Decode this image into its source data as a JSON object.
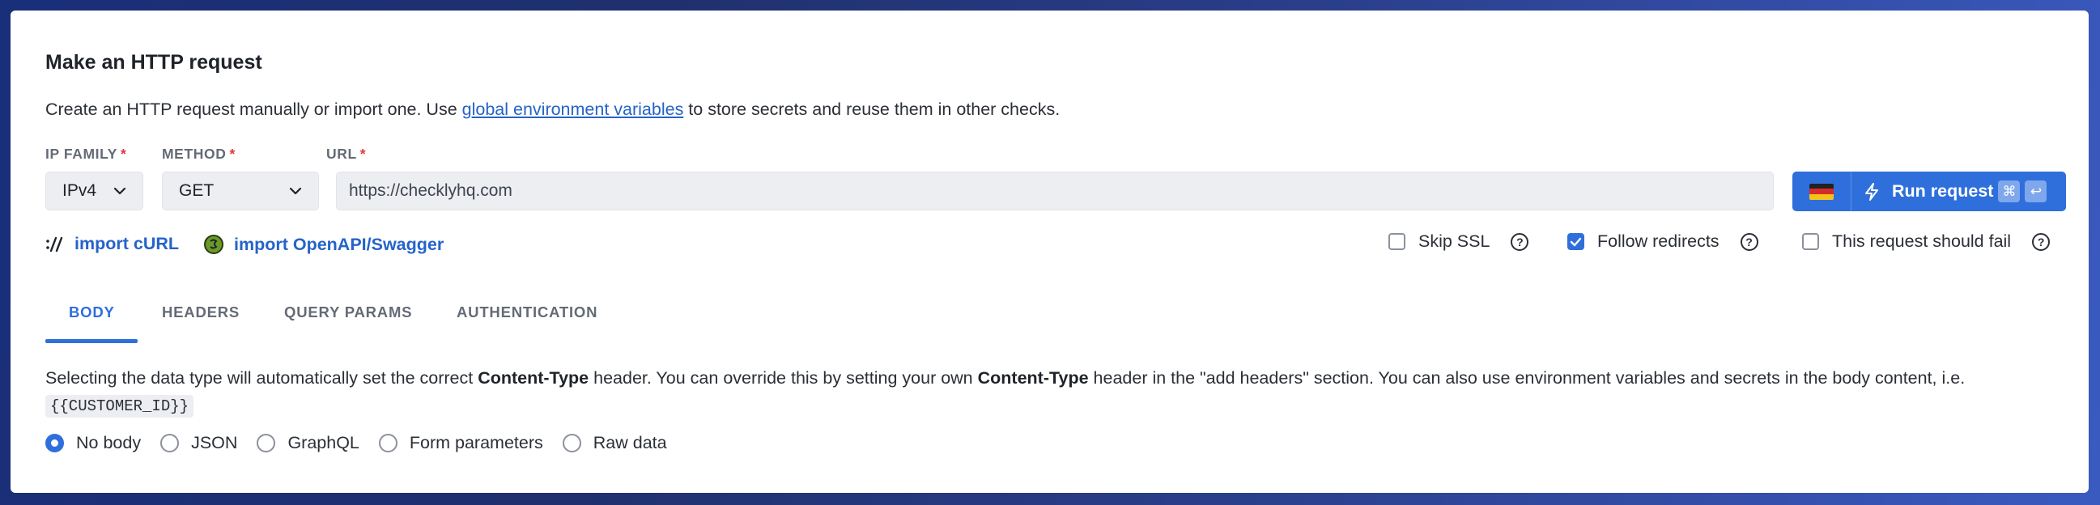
{
  "title": "Make an HTTP request",
  "intro": {
    "before": "Create an HTTP request manually or import one. Use ",
    "link": "global environment variables",
    "after": " to store secrets and reuse them in other checks."
  },
  "fields": {
    "ip_family": {
      "label": "IP FAMILY",
      "value": "IPv4"
    },
    "method": {
      "label": "METHOD",
      "value": "GET"
    },
    "url": {
      "label": "URL",
      "value": "https://checklyhq.com"
    },
    "required_marker": "*"
  },
  "run": {
    "label": "Run request",
    "region_flag": "germany-flag",
    "shortcut": [
      "⌘",
      "↩"
    ]
  },
  "imports": {
    "curl": "import cURL",
    "openapi": "import OpenAPI/Swagger"
  },
  "options": {
    "skip_ssl": {
      "label": "Skip SSL",
      "checked": false
    },
    "follow_redirects": {
      "label": "Follow redirects",
      "checked": true
    },
    "should_fail": {
      "label": "This request should fail",
      "checked": false
    },
    "help_glyph": "?"
  },
  "tabs": [
    "BODY",
    "HEADERS",
    "QUERY PARAMS",
    "AUTHENTICATION"
  ],
  "active_tab": "BODY",
  "body": {
    "desc_1": "Selecting the data type will automatically set the correct ",
    "desc_bold_1": "Content-Type",
    "desc_2": " header. You can override this by setting your own ",
    "desc_bold_2": "Content-Type",
    "desc_3": " header in the \"add headers\" section. You can also use environment variables and secrets in the body content, i.e.",
    "code": "{{CUSTOMER_ID}}",
    "types": [
      "No body",
      "JSON",
      "GraphQL",
      "Form parameters",
      "Raw data"
    ],
    "selected_type": "No body"
  },
  "colors": {
    "accent": "#2f6fdc",
    "link": "#2563c9",
    "required": "#e0373a"
  }
}
